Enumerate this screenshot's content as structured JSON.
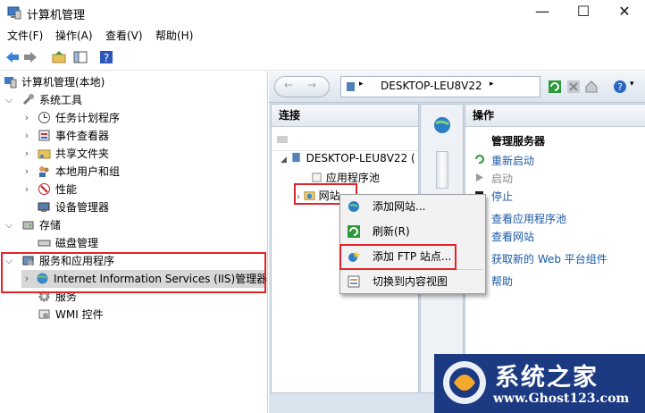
{
  "window": {
    "title": "计算机管理",
    "minimize": "—",
    "maximize": "☐",
    "close": "✕"
  },
  "menu": [
    "文件(F)",
    "操作(A)",
    "查看(V)",
    "帮助(H)"
  ],
  "tree": {
    "root": "计算机管理(本地)",
    "system_tools": "系统工具",
    "task_scheduler": "任务计划程序",
    "event_viewer": "事件查看器",
    "shared_folders": "共享文件夹",
    "local_users": "本地用户和组",
    "performance": "性能",
    "device_manager": "设备管理器",
    "storage": "存储",
    "disk_management": "磁盘管理",
    "services_apps": "服务和应用程序",
    "iis_manager": "Internet Information Services (IIS)管理器",
    "services": "服务",
    "wmi": "WMI 控件"
  },
  "iis": {
    "breadcrumb_host": "DESKTOP-LEU8V22",
    "connections_header": "连接",
    "conn_server": "DESKTOP-LEU8V22 (",
    "conn_app_pools": "应用程序池",
    "conn_sites": "网站",
    "actions_header": "操作",
    "actions_group": "管理服务器",
    "actions": [
      {
        "label": "重新启动",
        "enabled": true
      },
      {
        "label": "启动",
        "enabled": false
      },
      {
        "label": "停止",
        "enabled": true
      },
      {
        "label": "查看应用程序池",
        "enabled": true
      },
      {
        "label": "查看网站",
        "enabled": true
      },
      {
        "label": "获取新的 Web 平台组件",
        "enabled": true
      },
      {
        "label": "帮助",
        "enabled": true
      }
    ]
  },
  "context_menu": [
    "添加网站...",
    "刷新(R)",
    "添加 FTP 站点...",
    "切换到内容视图"
  ],
  "watermark": {
    "brand": "系统之家",
    "url": "www.Ghost123.com"
  },
  "colors": {
    "highlight_red": "#e1242a",
    "link_blue": "#1b59a6"
  }
}
